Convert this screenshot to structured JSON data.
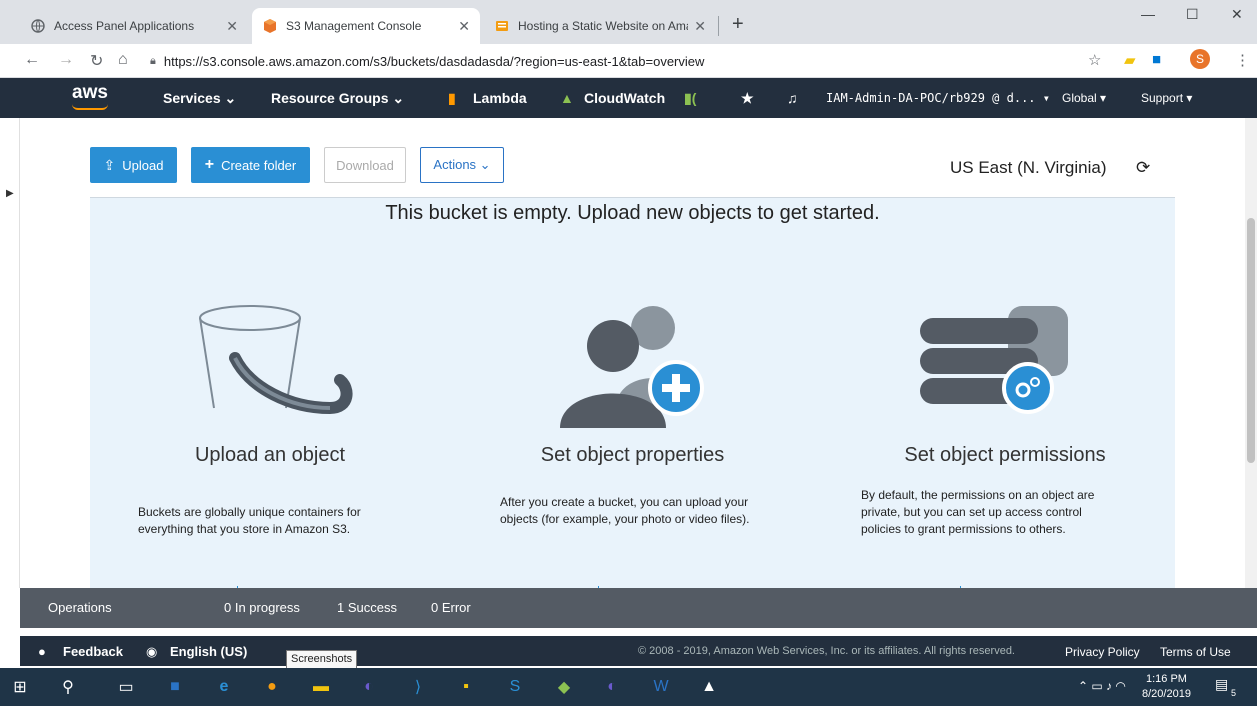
{
  "browser": {
    "tabs": [
      {
        "title": "Access Panel Applications"
      },
      {
        "title": "S3 Management Console"
      },
      {
        "title": "Hosting a Static Website on Ama"
      }
    ],
    "url": "https://s3.console.aws.amazon.com/s3/buckets/dasdadasda/?region=us-east-1&tab=overview",
    "profile_initial": "S"
  },
  "aws_nav": {
    "logo": "aws",
    "services": "Services ⌄",
    "resource_groups": "Resource Groups ⌄",
    "lambda": "Lambda",
    "cloudwatch": "CloudWatch",
    "account": "IAM-Admin-DA-POC/rb929 @ d... ▾",
    "region": "Global ▾",
    "support": "Support ▾"
  },
  "toolbar": {
    "upload": "Upload",
    "create_folder": "Create folder",
    "download": "Download",
    "actions": "Actions ⌄",
    "region_label": "US East (N. Virginia)"
  },
  "panel": {
    "empty_message": "This bucket is empty. Upload new objects to get started.",
    "columns": [
      {
        "title": "Upload an object",
        "desc": "Buckets are globally unique containers for everything that you store in Amazon S3."
      },
      {
        "title": "Set object properties",
        "desc": "After you create a bucket, you can upload your objects (for example, your photo or video files)."
      },
      {
        "title": "Set object permissions",
        "desc": "By default, the permissions on an object are private, but you can set up access control policies to grant permissions to others."
      }
    ]
  },
  "operations": {
    "label": "Operations",
    "in_progress": "0 In progress",
    "success": "1 Success",
    "error": "0 Error"
  },
  "footer": {
    "feedback": "Feedback",
    "language": "English (US)",
    "copyright": "© 2008 - 2019, Amazon Web Services, Inc. or its affiliates. All rights reserved.",
    "privacy": "Privacy Policy",
    "terms": "Terms of Use",
    "tooltip": "Screenshots"
  },
  "taskbar": {
    "time": "1:16 PM",
    "date": "8/20/2019",
    "notification_count": "5"
  },
  "colors": {
    "aws_nav": "#232f3e",
    "primary_button": "#2a8fd4",
    "panel_bg": "#e9f3fb",
    "ops_bar": "#545b64"
  }
}
